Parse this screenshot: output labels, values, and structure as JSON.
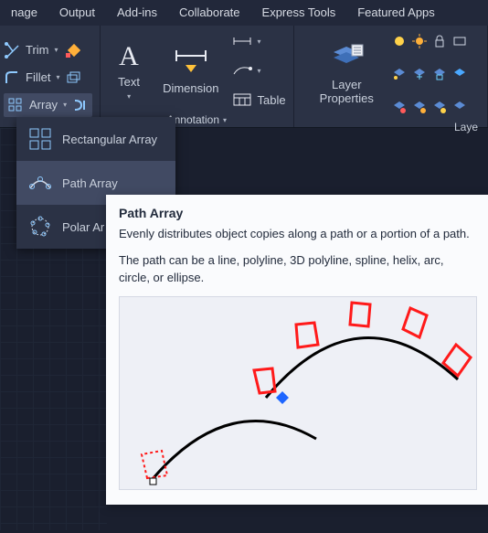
{
  "menubar": {
    "items": [
      "nage",
      "Output",
      "Add-ins",
      "Collaborate",
      "Express Tools",
      "Featured Apps"
    ]
  },
  "ribbon": {
    "modify": {
      "trim": "Trim",
      "fillet": "Fillet",
      "array": "Array"
    },
    "text_label": "Text",
    "dimension_label": "Dimension",
    "table_label": "Table",
    "annotation_label": "Annotation",
    "layer_props": "Layer\nProperties",
    "layer_panel_label": "Laye"
  },
  "array_menu": {
    "rectangular": "Rectangular Array",
    "path": "Path Array",
    "polar": "Polar Ar"
  },
  "tooltip": {
    "title": "Path Array",
    "p1": "Evenly distributes object copies along a path or a portion of a path.",
    "p2": "The path can be a line, polyline, 3D polyline, spline, helix, arc, circle, or ellipse."
  }
}
